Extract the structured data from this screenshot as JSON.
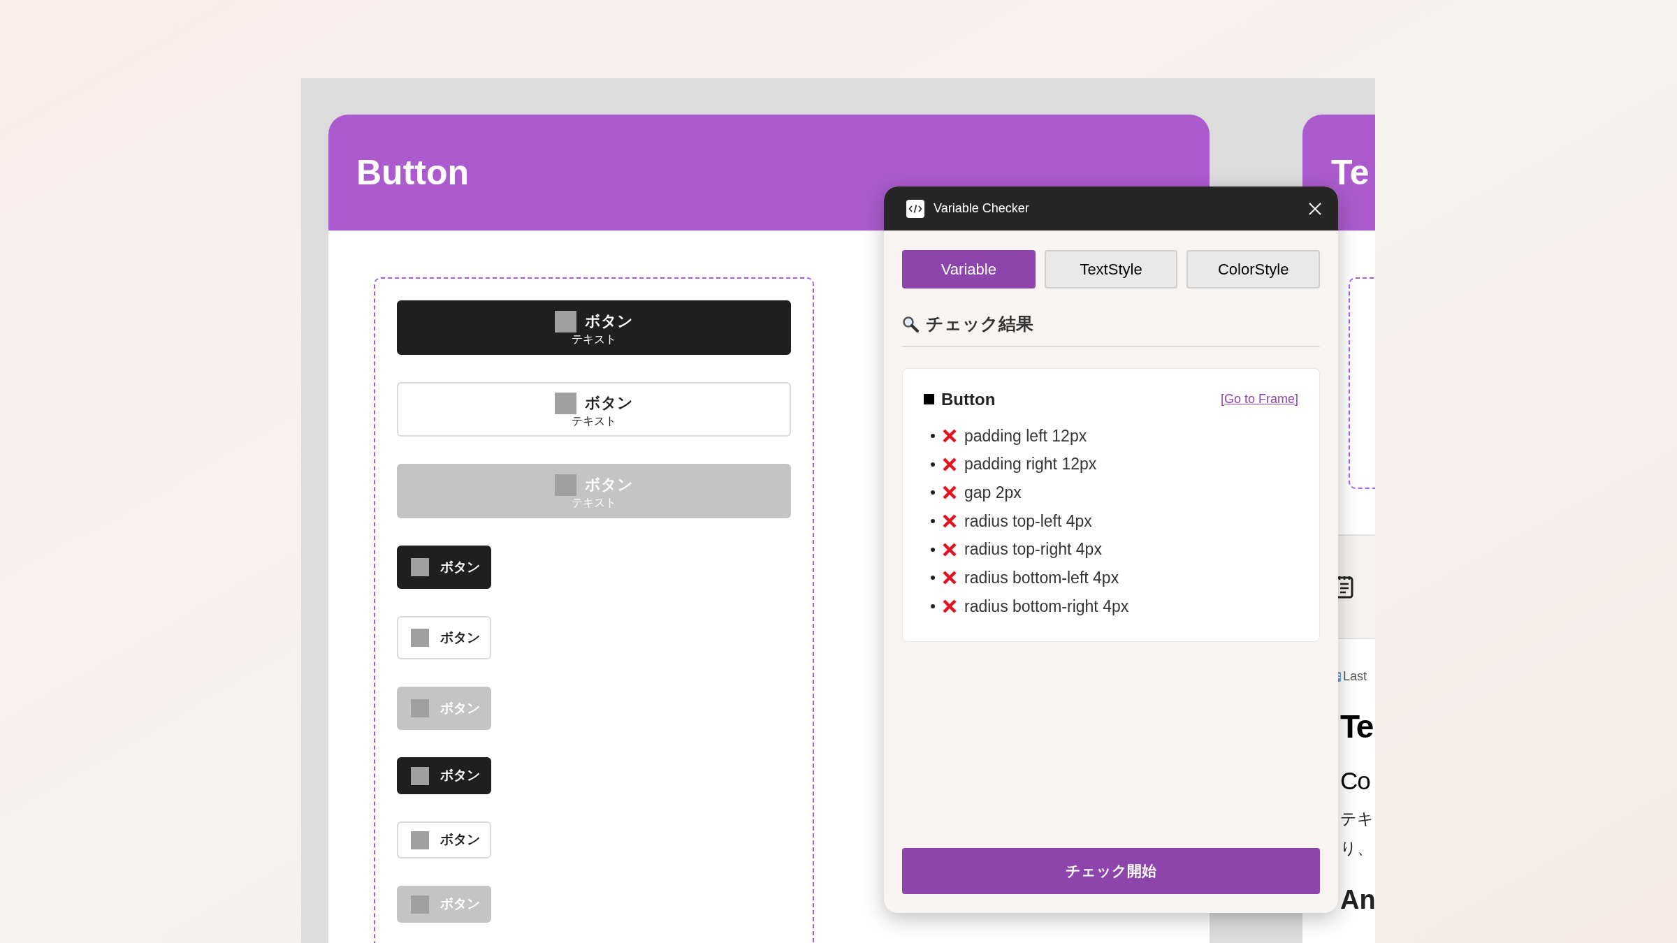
{
  "canvas": {
    "frames": [
      {
        "title": "Button",
        "variants": [
          {
            "kind": "primary",
            "label": "ボタン",
            "sublabel": "テキスト"
          },
          {
            "kind": "secondary",
            "label": "ボタン",
            "sublabel": "テキスト"
          },
          {
            "kind": "disabled",
            "label": "ボタン",
            "sublabel": "テキスト"
          },
          {
            "kind": "primary",
            "label": "ボタン"
          },
          {
            "kind": "secondary",
            "label": "ボタン"
          },
          {
            "kind": "disabled",
            "label": "ボタン"
          },
          {
            "kind": "primary",
            "label": "ボタン"
          },
          {
            "kind": "secondary",
            "label": "ボタン"
          },
          {
            "kind": "disabled",
            "label": "ボタン"
          }
        ]
      },
      {
        "title": "Te",
        "doc": [
          {
            "kind": "meta",
            "text": "Last"
          },
          {
            "kind": "h1",
            "text": "Te"
          },
          {
            "kind": "h2",
            "text": "Co"
          },
          {
            "kind": "p",
            "text": "テキ"
          },
          {
            "kind": "p",
            "text": "り、"
          },
          {
            "kind": "h3",
            "text": "An"
          }
        ]
      }
    ]
  },
  "plugin": {
    "title": "Variable Checker",
    "tabs": [
      {
        "label": "Variable",
        "selected": true
      },
      {
        "label": "TextStyle",
        "selected": false
      },
      {
        "label": "ColorStyle",
        "selected": false
      }
    ],
    "results_heading": "チェック結果",
    "result": {
      "name": "Button",
      "link": "[Go to Frame]",
      "items": [
        {
          "text": "padding left 12px",
          "passed": false
        },
        {
          "text": "padding right 12px",
          "passed": false
        },
        {
          "text": "gap 2px",
          "passed": false
        },
        {
          "text": "radius top-left 4px",
          "passed": false
        },
        {
          "text": "radius top-right 4px",
          "passed": false
        },
        {
          "text": "radius bottom-left 4px",
          "passed": false
        },
        {
          "text": "radius bottom-right 4px",
          "passed": false
        }
      ]
    },
    "action": "チェック開始"
  }
}
